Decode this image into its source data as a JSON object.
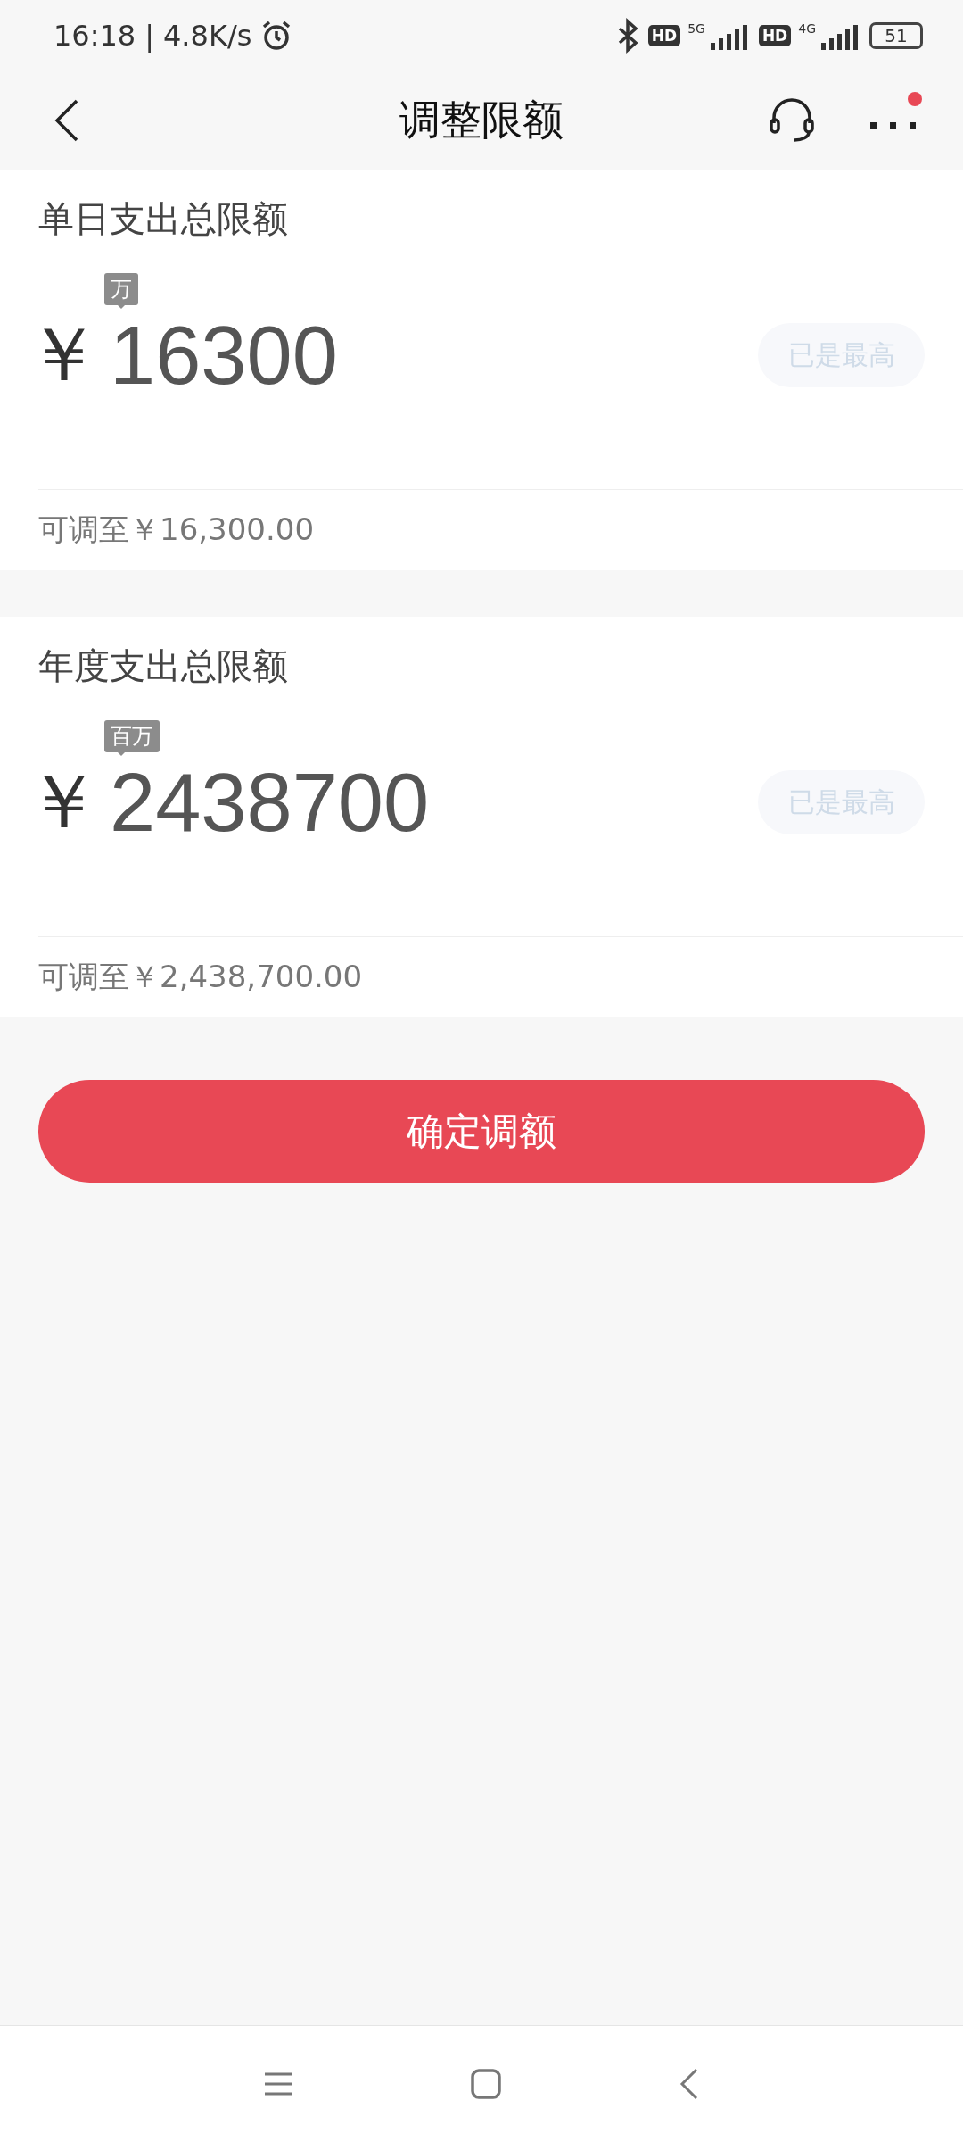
{
  "status_bar": {
    "time": "16:18",
    "separator": "|",
    "speed": "4.8K/s",
    "hd_badges": [
      "HD",
      "HD"
    ],
    "network_labels": [
      "5G",
      "4G"
    ],
    "battery": "51"
  },
  "header": {
    "title": "调整限额",
    "more_has_notification": true
  },
  "limits": [
    {
      "title": "单日支出总限额",
      "currency": "￥",
      "unit_badge": "万",
      "amount": "16300",
      "max_button": {
        "label": "已是最高",
        "disabled": true
      },
      "hint": "可调至￥16,300.00"
    },
    {
      "title": "年度支出总限额",
      "currency": "￥",
      "unit_badge": "百万",
      "amount": "2438700",
      "max_button": {
        "label": "已是最高",
        "disabled": true
      },
      "hint": "可调至￥2,438,700.00"
    }
  ],
  "confirm_button": {
    "label": "确定调额"
  }
}
